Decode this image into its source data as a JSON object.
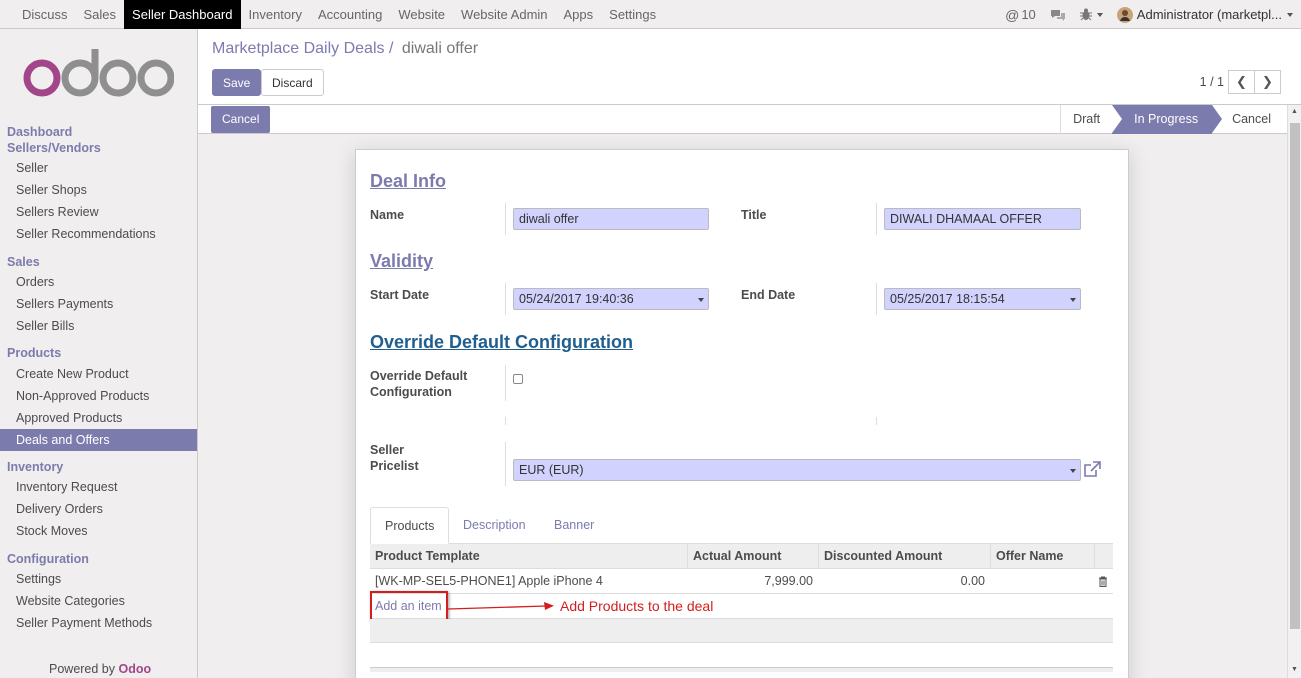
{
  "topbar": {
    "menu": [
      "Discuss",
      "Sales",
      "Seller Dashboard",
      "Inventory",
      "Accounting",
      "Website",
      "Website Admin",
      "Apps",
      "Settings"
    ],
    "active_index": 2,
    "mentions_count": "10",
    "user": "Administrator (marketpl..."
  },
  "sidebar": {
    "sections": [
      {
        "title": "Dashboard",
        "items": []
      },
      {
        "title": "Sellers/Vendors",
        "items": [
          "Seller",
          "Seller Shops",
          "Sellers Review",
          "Seller Recommendations"
        ]
      },
      {
        "title": "Sales",
        "items": [
          "Orders",
          "Sellers Payments",
          "Seller Bills"
        ]
      },
      {
        "title": "Products",
        "items": [
          "Create New Product",
          "Non-Approved Products",
          "Approved Products",
          "Deals and Offers"
        ]
      },
      {
        "title": "Inventory",
        "items": [
          "Inventory Request",
          "Delivery Orders",
          "Stock Moves"
        ]
      },
      {
        "title": "Configuration",
        "items": [
          "Settings",
          "Website Categories",
          "Seller Payment Methods"
        ]
      }
    ],
    "active_item": "Deals and Offers",
    "powered_prefix": "Powered by",
    "powered_brand": "Odoo"
  },
  "control_panel": {
    "breadcrumb_parent": "Marketplace Daily Deals",
    "breadcrumb_sep": "/",
    "breadcrumb_current": "diwali offer",
    "save_label": "Save",
    "discard_label": "Discard",
    "pager": "1 / 1"
  },
  "statusbar": {
    "cancel_label": "Cancel",
    "stages": [
      "Draft",
      "In Progress",
      "Cancel"
    ],
    "active_stage": "In Progress"
  },
  "form": {
    "deal_info_title": "Deal Info",
    "name_label": "Name",
    "name_value": "diwali offer",
    "title_label": "Title",
    "title_value": "DIWALI DHAMAAL OFFER",
    "validity_title": "Validity",
    "start_label": "Start Date",
    "start_value": "05/24/2017 19:40:36",
    "end_label": "End Date",
    "end_value": "05/25/2017 18:15:54",
    "override_title": "Override Default Configuration",
    "override_label_1": "Override Default",
    "override_label_2": "Configuration",
    "override_checked": false,
    "pricelist_label_1": "Seller",
    "pricelist_label_2": "Pricelist",
    "pricelist_value": "EUR (EUR)"
  },
  "tabs": [
    "Products",
    "Description",
    "Banner"
  ],
  "active_tab": "Products",
  "products_table": {
    "columns": [
      "Product Template",
      "Actual Amount",
      "Discounted Amount",
      "Offer Name"
    ],
    "rows": [
      {
        "product": "[WK-MP-SEL5-PHONE1] Apple iPhone 4",
        "actual": "7,999.00",
        "discounted": "0.00",
        "offer": ""
      }
    ],
    "add_item_label": "Add an item"
  },
  "annotation": {
    "text": "Add Products to the deal",
    "color": "#d21e1e"
  },
  "colors": {
    "brand": "#7c7bad",
    "field_bg": "#d2d2ff",
    "odoo_logo": "#a24689"
  }
}
